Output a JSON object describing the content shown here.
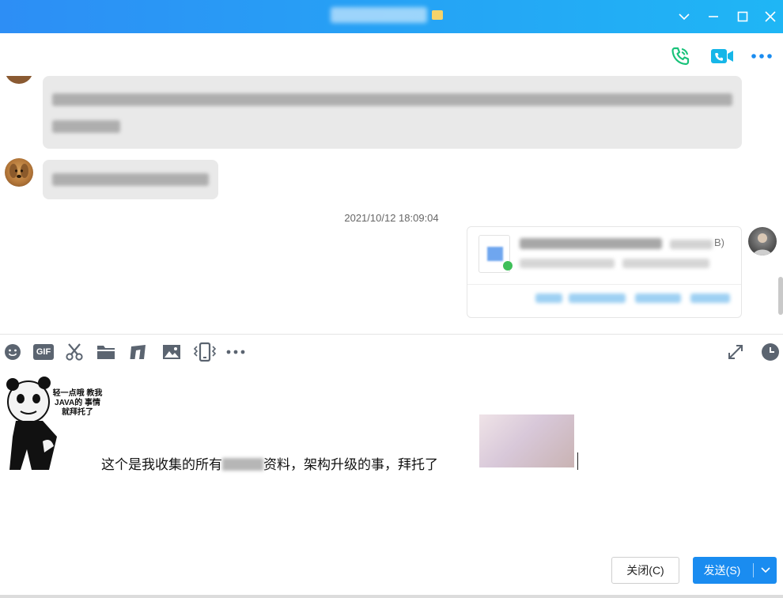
{
  "window": {
    "title": "",
    "controls": [
      "chevron-down-icon",
      "minimize-icon",
      "maximize-icon",
      "close-icon"
    ]
  },
  "callbar": {
    "icons": [
      "voice-call-icon",
      "video-call-icon",
      "more-icon"
    ],
    "colors": {
      "voice": "#19c27a",
      "video": "#16b6e8",
      "more": "#1a8cf0"
    }
  },
  "messages": {
    "timestamp": "2021/10/12 18:09:04",
    "file_card": {
      "size_suffix": "B)"
    }
  },
  "toolbar": {
    "icons": [
      "emoji-icon",
      "gif-icon",
      "screenshot-scissors-icon",
      "folder-icon",
      "music-icon",
      "image-icon",
      "shake-icon",
      "more-tools-icon"
    ],
    "gif_label": "GIF",
    "right_icons": [
      "expand-icon",
      "history-clock-icon"
    ]
  },
  "editor": {
    "sticker_text": "轻一点哦 教我JAVA的 事情就拜托了",
    "typed_before": "这个是我收集的所有",
    "typed_after": "资料，架构升级的事，拜托了"
  },
  "footer": {
    "close_label": "关闭(C)",
    "send_label": "发送(S)"
  }
}
